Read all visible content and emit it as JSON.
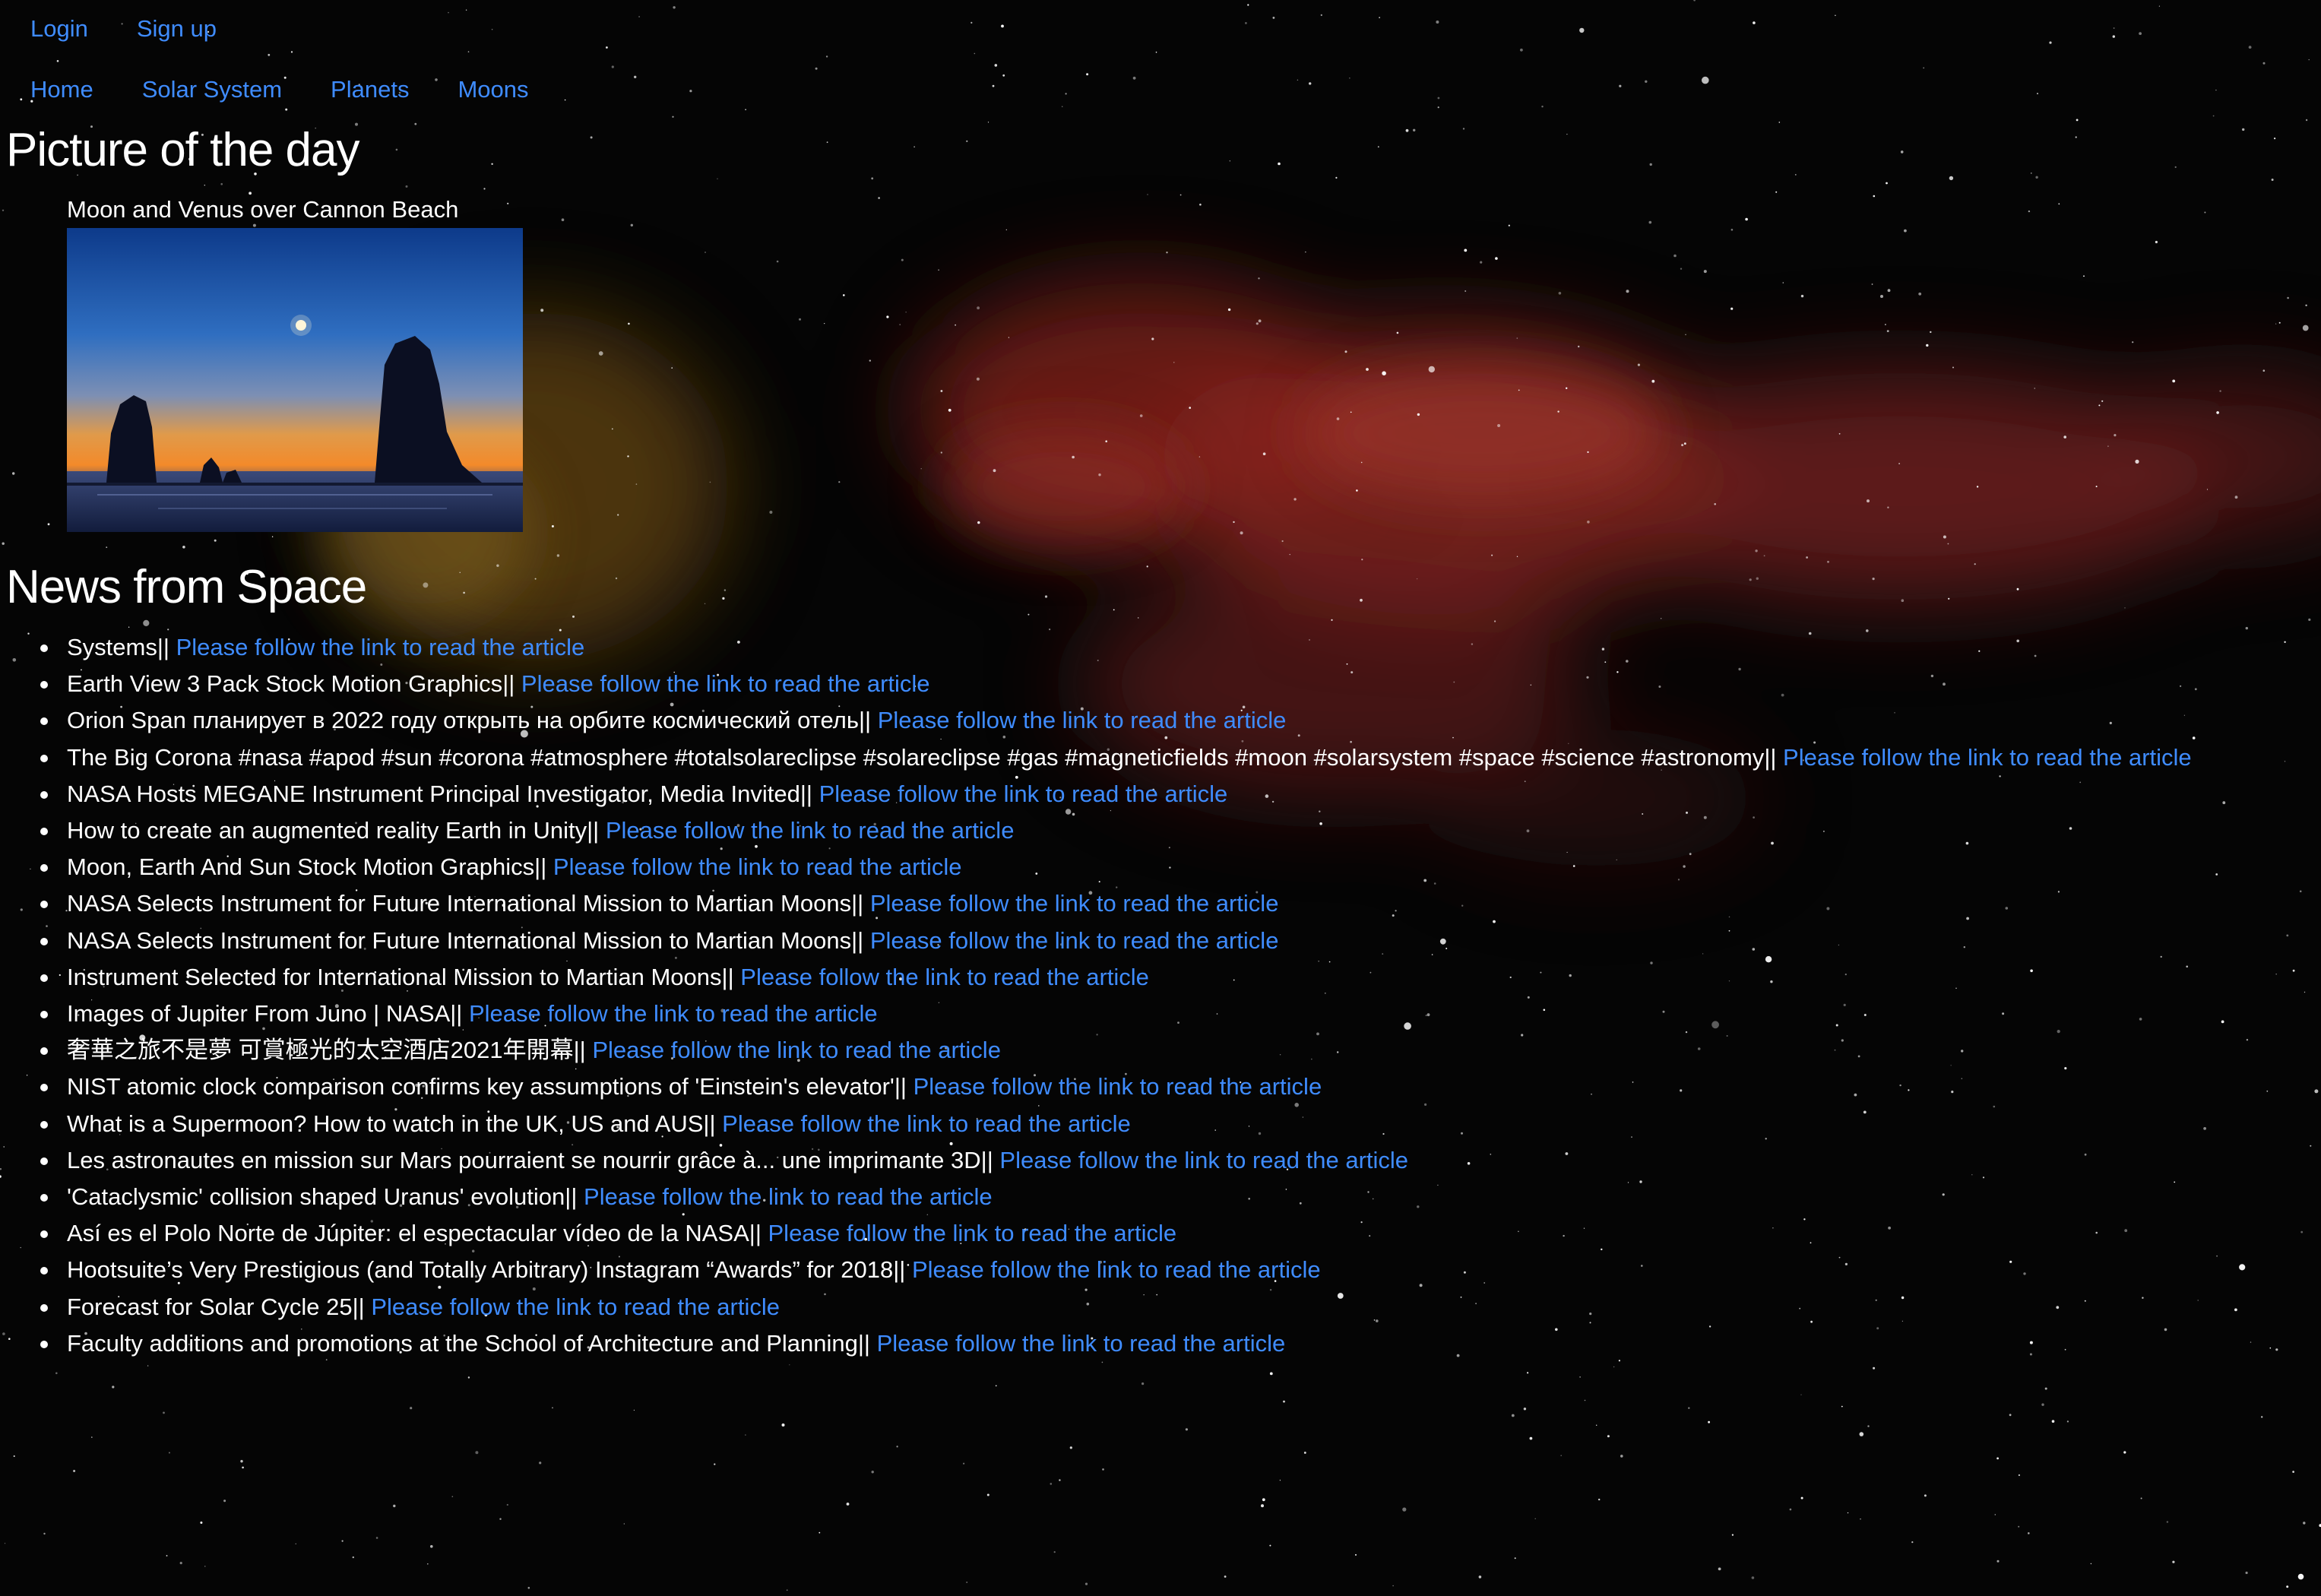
{
  "auth_nav": {
    "login": "Login",
    "signup": "Sign up"
  },
  "main_nav": {
    "home": "Home",
    "solar_system": "Solar System",
    "planets": "Planets",
    "moons": "Moons"
  },
  "picture_of_the_day": {
    "heading": "Picture of the day",
    "caption": "Moon and Venus over Cannon Beach"
  },
  "news": {
    "heading": "News from Space",
    "separator": "||",
    "items": [
      {
        "title": "Systems",
        "link": "Please follow the link to read the article"
      },
      {
        "title": "Earth View 3 Pack Stock Motion Graphics",
        "link": "Please follow the link to read the article"
      },
      {
        "title": "Orion Span планирует в 2022 году открыть на орбите космический отель",
        "link": "Please follow the link to read the article"
      },
      {
        "title": "The Big Corona #nasa #apod #sun #corona #atmosphere #totalsolareclipse #solareclipse #gas #magneticfields #moon #solarsystem #space #science #astronomy",
        "link": "Please follow the link to read the article"
      },
      {
        "title": "NASA Hosts MEGANE Instrument Principal Investigator, Media Invited",
        "link": "Please follow the link to read the article"
      },
      {
        "title": "How to create an augmented reality Earth in Unity",
        "link": "Please follow the link to read the article"
      },
      {
        "title": "Moon, Earth And Sun Stock Motion Graphics",
        "link": "Please follow the link to read the article"
      },
      {
        "title": "NASA Selects Instrument for Future International Mission to Martian Moons",
        "link": "Please follow the link to read the article"
      },
      {
        "title": "NASA Selects Instrument for Future International Mission to Martian Moons",
        "link": "Please follow the link to read the article"
      },
      {
        "title": "Instrument Selected for International Mission to Martian Moons",
        "link": "Please follow the link to read the article"
      },
      {
        "title": "Images of Jupiter From Juno | NASA",
        "link": "Please follow the link to read the article"
      },
      {
        "title": "奢華之旅不是夢 可賞極光的太空酒店2021年開幕",
        "link": "Please follow the link to read the article"
      },
      {
        "title": "NIST atomic clock comparison confirms key assumptions of 'Einstein's elevator'",
        "link": "Please follow the link to read the article"
      },
      {
        "title": "What is a Supermoon? How to watch in the UK, US and AUS",
        "link": "Please follow the link to read the article"
      },
      {
        "title": "Les astronautes en mission sur Mars pourraient se nourrir grâce à... une imprimante 3D",
        "link": "Please follow the link to read the article"
      },
      {
        "title": "'Cataclysmic' collision shaped Uranus' evolution",
        "link": "Please follow the link to read the article"
      },
      {
        "title": "Así es el Polo Norte de Júpiter: el espectacular vídeo de la NASA",
        "link": "Please follow the link to read the article"
      },
      {
        "title": "Hootsuite’s Very Prestigious (and Totally Arbitrary) Instagram “Awards” for 2018",
        "link": "Please follow the link to read the article"
      },
      {
        "title": "Forecast for Solar Cycle 25",
        "link": "Please follow the link to read the article"
      },
      {
        "title": "Faculty additions and promotions at the School of Architecture and Planning",
        "link": "Please follow the link to read the article"
      }
    ]
  }
}
